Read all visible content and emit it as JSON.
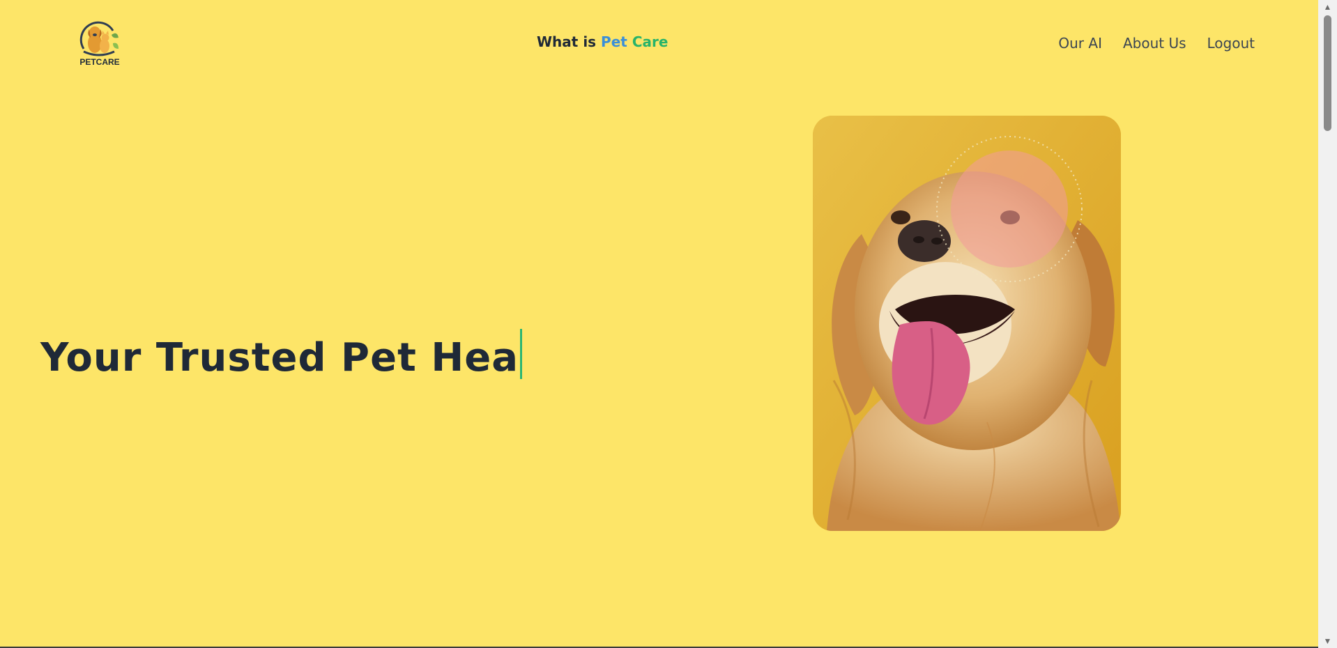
{
  "header": {
    "logo_text": "PETCARE",
    "title_prefix": "What is ",
    "title_pet": "Pet",
    "title_care": "Care",
    "nav": [
      "Our AI",
      "About Us",
      "Logout"
    ]
  },
  "hero": {
    "heading": "Your Trusted Pet Hea",
    "image_alt": "golden retriever smiling"
  },
  "colors": {
    "background": "#fde568",
    "text_dark": "#1f2937",
    "pet_blue": "#3a8fd8",
    "care_green": "#27b36a",
    "caret_green": "#2bb673"
  },
  "icons": {
    "logo": "dog-and-cat-logo-icon",
    "scroll_up": "scroll-up-arrow-icon",
    "scroll_down": "scroll-down-arrow-icon"
  }
}
